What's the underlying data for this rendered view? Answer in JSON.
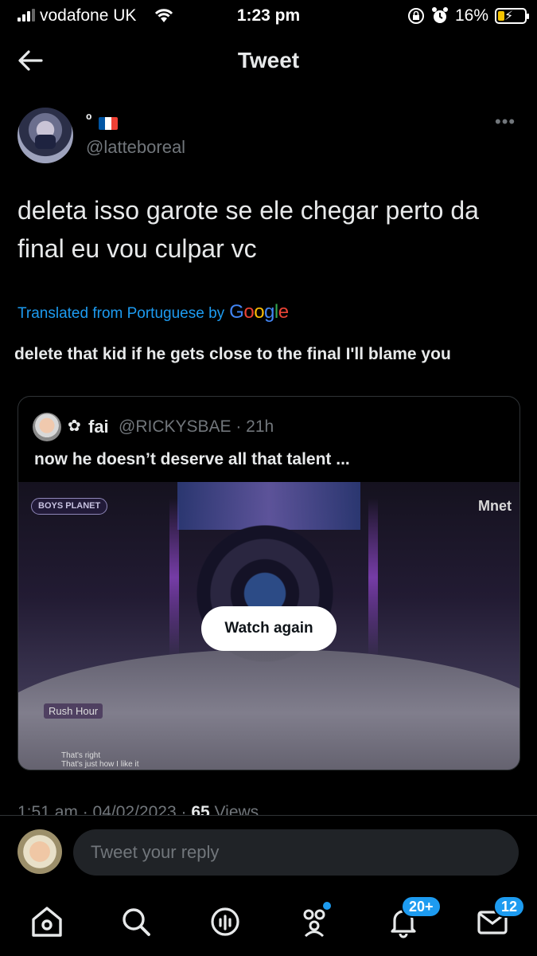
{
  "status_bar": {
    "carrier": "vodafone UK",
    "time": "1:23 pm",
    "battery_percent": "16%",
    "battery_level": 0.16
  },
  "header": {
    "title": "Tweet"
  },
  "tweet": {
    "display_name": "º",
    "handle": "@latteboreal",
    "text": "deleta isso garote se ele chegar perto da final eu vou culpar vc",
    "translated_label": "Translated from Portuguese by",
    "translation_provider": "Google",
    "translation": "delete that kid if he gets close to the final I'll blame you",
    "timestamp": "1:51 am · 04/02/2023 ·",
    "views_count": "65",
    "views_label": "Views"
  },
  "quote": {
    "name": "fai",
    "handle_time": "@RICKYSBAE · 21h",
    "text": "now he doesn’t deserve all that talent ...",
    "video": {
      "watch_again_label": "Watch again",
      "logo_text": "BOYS PLANET",
      "channel": "Mnet",
      "song": "Rush Hour",
      "subtitle_1": "That's right",
      "subtitle_2": "That's just how I like it"
    }
  },
  "reply": {
    "placeholder": "Tweet your reply"
  },
  "tabs": {
    "notifications_badge": "20+",
    "messages_badge": "12"
  },
  "colors": {
    "accent": "#1d9bf0",
    "background": "#000000",
    "secondary_text": "#71767b"
  }
}
